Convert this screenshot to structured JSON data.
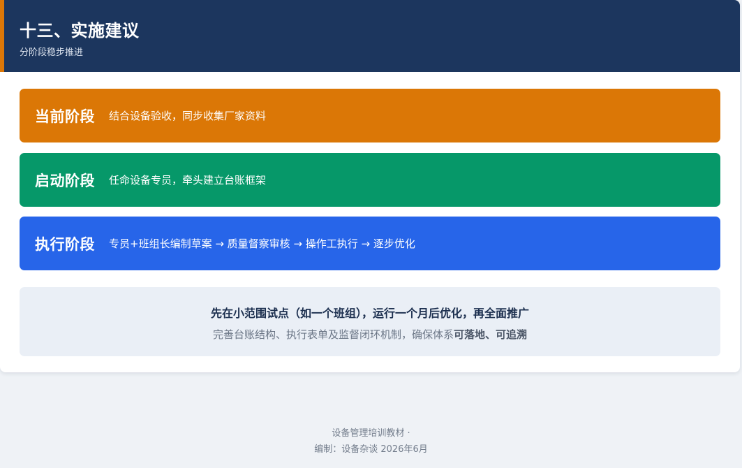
{
  "section": {
    "title": "十三、实施建议",
    "subtitle": "分阶段稳步推进"
  },
  "phases": [
    {
      "name": "当前阶段",
      "description": "结合设备验收，同步收集厂家资料",
      "color": "#db7706"
    },
    {
      "name": "启动阶段",
      "description": "任命设备专员，牵头建立台账框架",
      "color": "#069869"
    },
    {
      "name": "执行阶段",
      "description": "专员+班组长编制草案 → 质量督察审核 → 操作工执行 → 逐步优化",
      "color": "#2765e9"
    }
  ],
  "note": {
    "main": "先在小范围试点（如一个班组），运行一个月后优化，再全面推广",
    "sub_prefix": "完善台账结构、执行表单及监督闭环机制，确保体系",
    "sub_emphasis": "可落地、可追溯"
  },
  "footer": {
    "line1": "设备管理培训教材 ·",
    "line2": "编制：设备杂谈  2026年6月"
  },
  "colors": {
    "header_bg": "#1c365e",
    "accent": "#dc7707",
    "page_bg": "#eff2f6"
  }
}
